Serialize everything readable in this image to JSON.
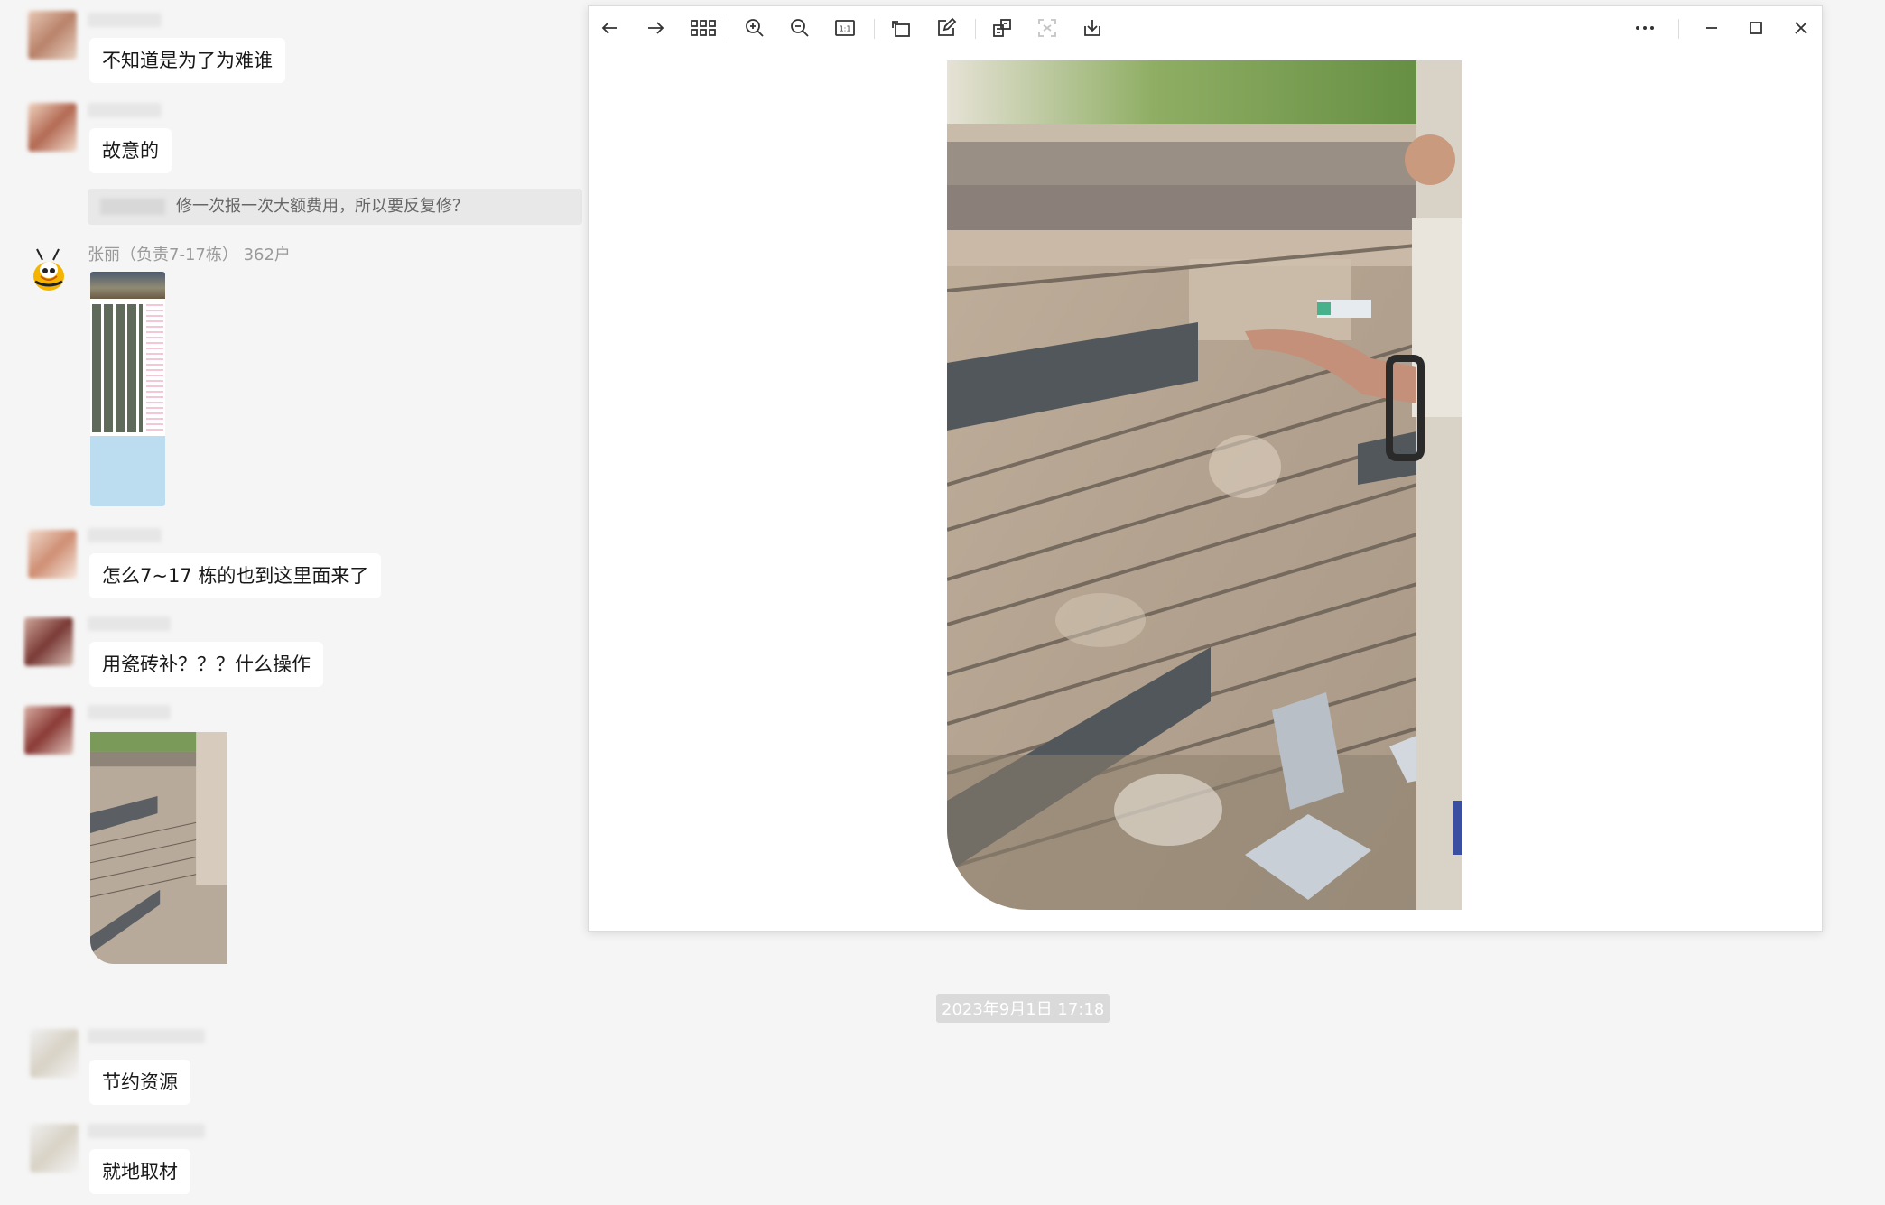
{
  "chat": {
    "messages": [
      {
        "text": "不知道是为了为难谁"
      },
      {
        "text": "故意的"
      },
      {
        "text": "修一次报一次大额费用，所以要反复修？"
      },
      {
        "sender": "张丽（负责7-17栋） 362户"
      },
      {
        "text": "怎么7~17 栋的也到这里面来了"
      },
      {
        "text": "用瓷砖补？？？什么操作"
      },
      {
        "text": "节约资源"
      },
      {
        "text": "就地取材"
      }
    ],
    "timestamp": "2023年9月1日 17:18"
  },
  "viewer": {
    "toolbar": {
      "icons": [
        "back-arrow-icon",
        "forward-arrow-icon",
        "grid-icon",
        "zoom-in-icon",
        "zoom-out-icon",
        "actual-size-icon",
        "rotate-icon",
        "edit-icon",
        "translate-icon",
        "scan-icon",
        "download-icon",
        "more-icon",
        "minimize-icon",
        "maximize-icon",
        "close-icon"
      ],
      "actual_size_label": "1:1"
    }
  }
}
